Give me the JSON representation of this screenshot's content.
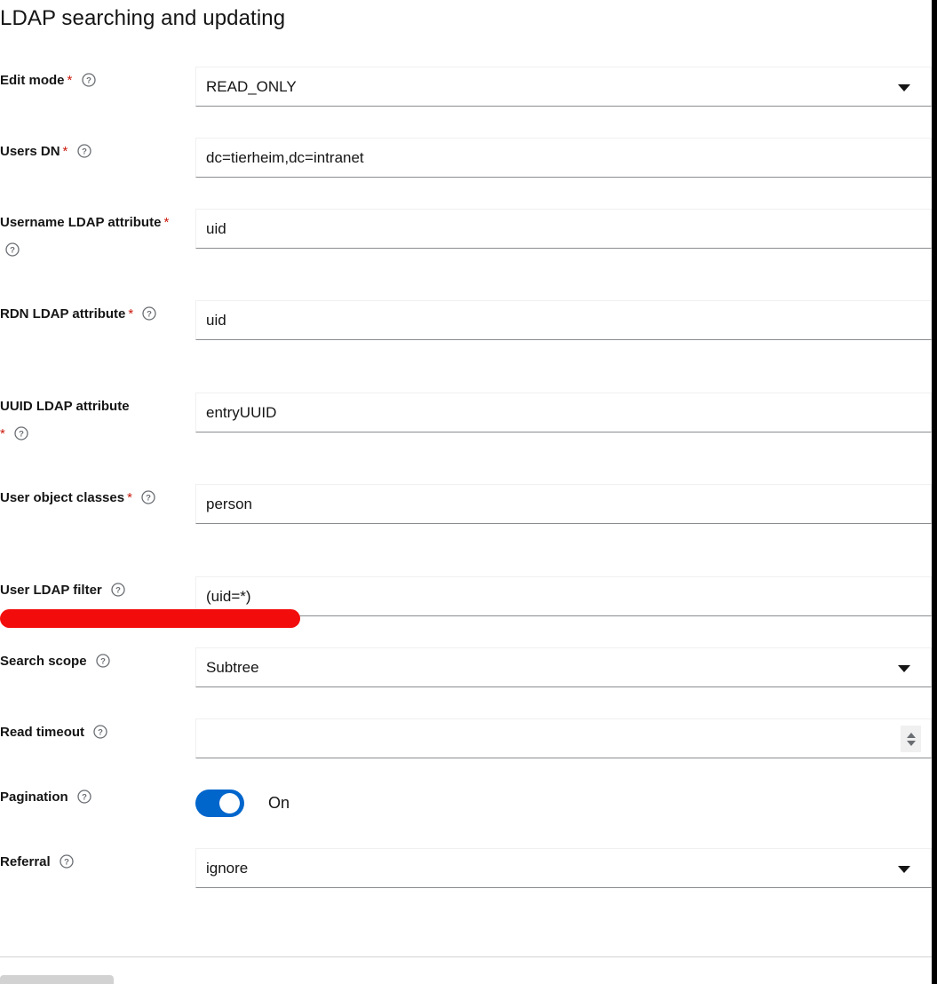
{
  "page": {
    "title": "LDAP searching and updating",
    "required_marker": "*",
    "help_icon": "question-circle-icon",
    "accent_color": "#0066cc",
    "required_color": "#c9190b",
    "redaction_color": "#f20c0c"
  },
  "fields": [
    {
      "label": "Edit mode",
      "required": true,
      "has_help": true,
      "type": "select",
      "value": "READ_ONLY",
      "icon": "chevron-down-icon"
    },
    {
      "label": "Users DN",
      "required": true,
      "has_help": true,
      "type": "text",
      "value": "dc=tierheim,dc=intranet",
      "icon": ""
    },
    {
      "label": "Username LDAP attribute",
      "required": true,
      "has_help": true,
      "type": "text",
      "value": "uid",
      "icon": ""
    },
    {
      "label": "RDN LDAP attribute",
      "required": true,
      "has_help": true,
      "type": "text",
      "value": "uid",
      "icon": ""
    },
    {
      "label": "UUID LDAP attribute",
      "required": true,
      "has_help": true,
      "type": "text",
      "value": "entryUUID",
      "icon": ""
    },
    {
      "label": "User object classes",
      "required": true,
      "has_help": true,
      "type": "text",
      "value": "person",
      "icon": ""
    },
    {
      "label": "User LDAP filter",
      "required": false,
      "has_help": true,
      "type": "text",
      "value": "(uid=*)",
      "icon": ""
    },
    {
      "label": "Search scope",
      "required": false,
      "has_help": true,
      "type": "select",
      "value": "Subtree",
      "icon": "chevron-down-icon"
    },
    {
      "label": "Read timeout",
      "required": false,
      "has_help": true,
      "type": "number",
      "value": "",
      "icon": "spinner-stepper-icon"
    },
    {
      "label": "Pagination",
      "required": false,
      "has_help": true,
      "type": "switch",
      "value": "On",
      "icon": "toggle-on-icon"
    },
    {
      "label": "Referral",
      "required": false,
      "has_help": true,
      "type": "select",
      "value": "ignore",
      "icon": "chevron-down-icon"
    }
  ]
}
